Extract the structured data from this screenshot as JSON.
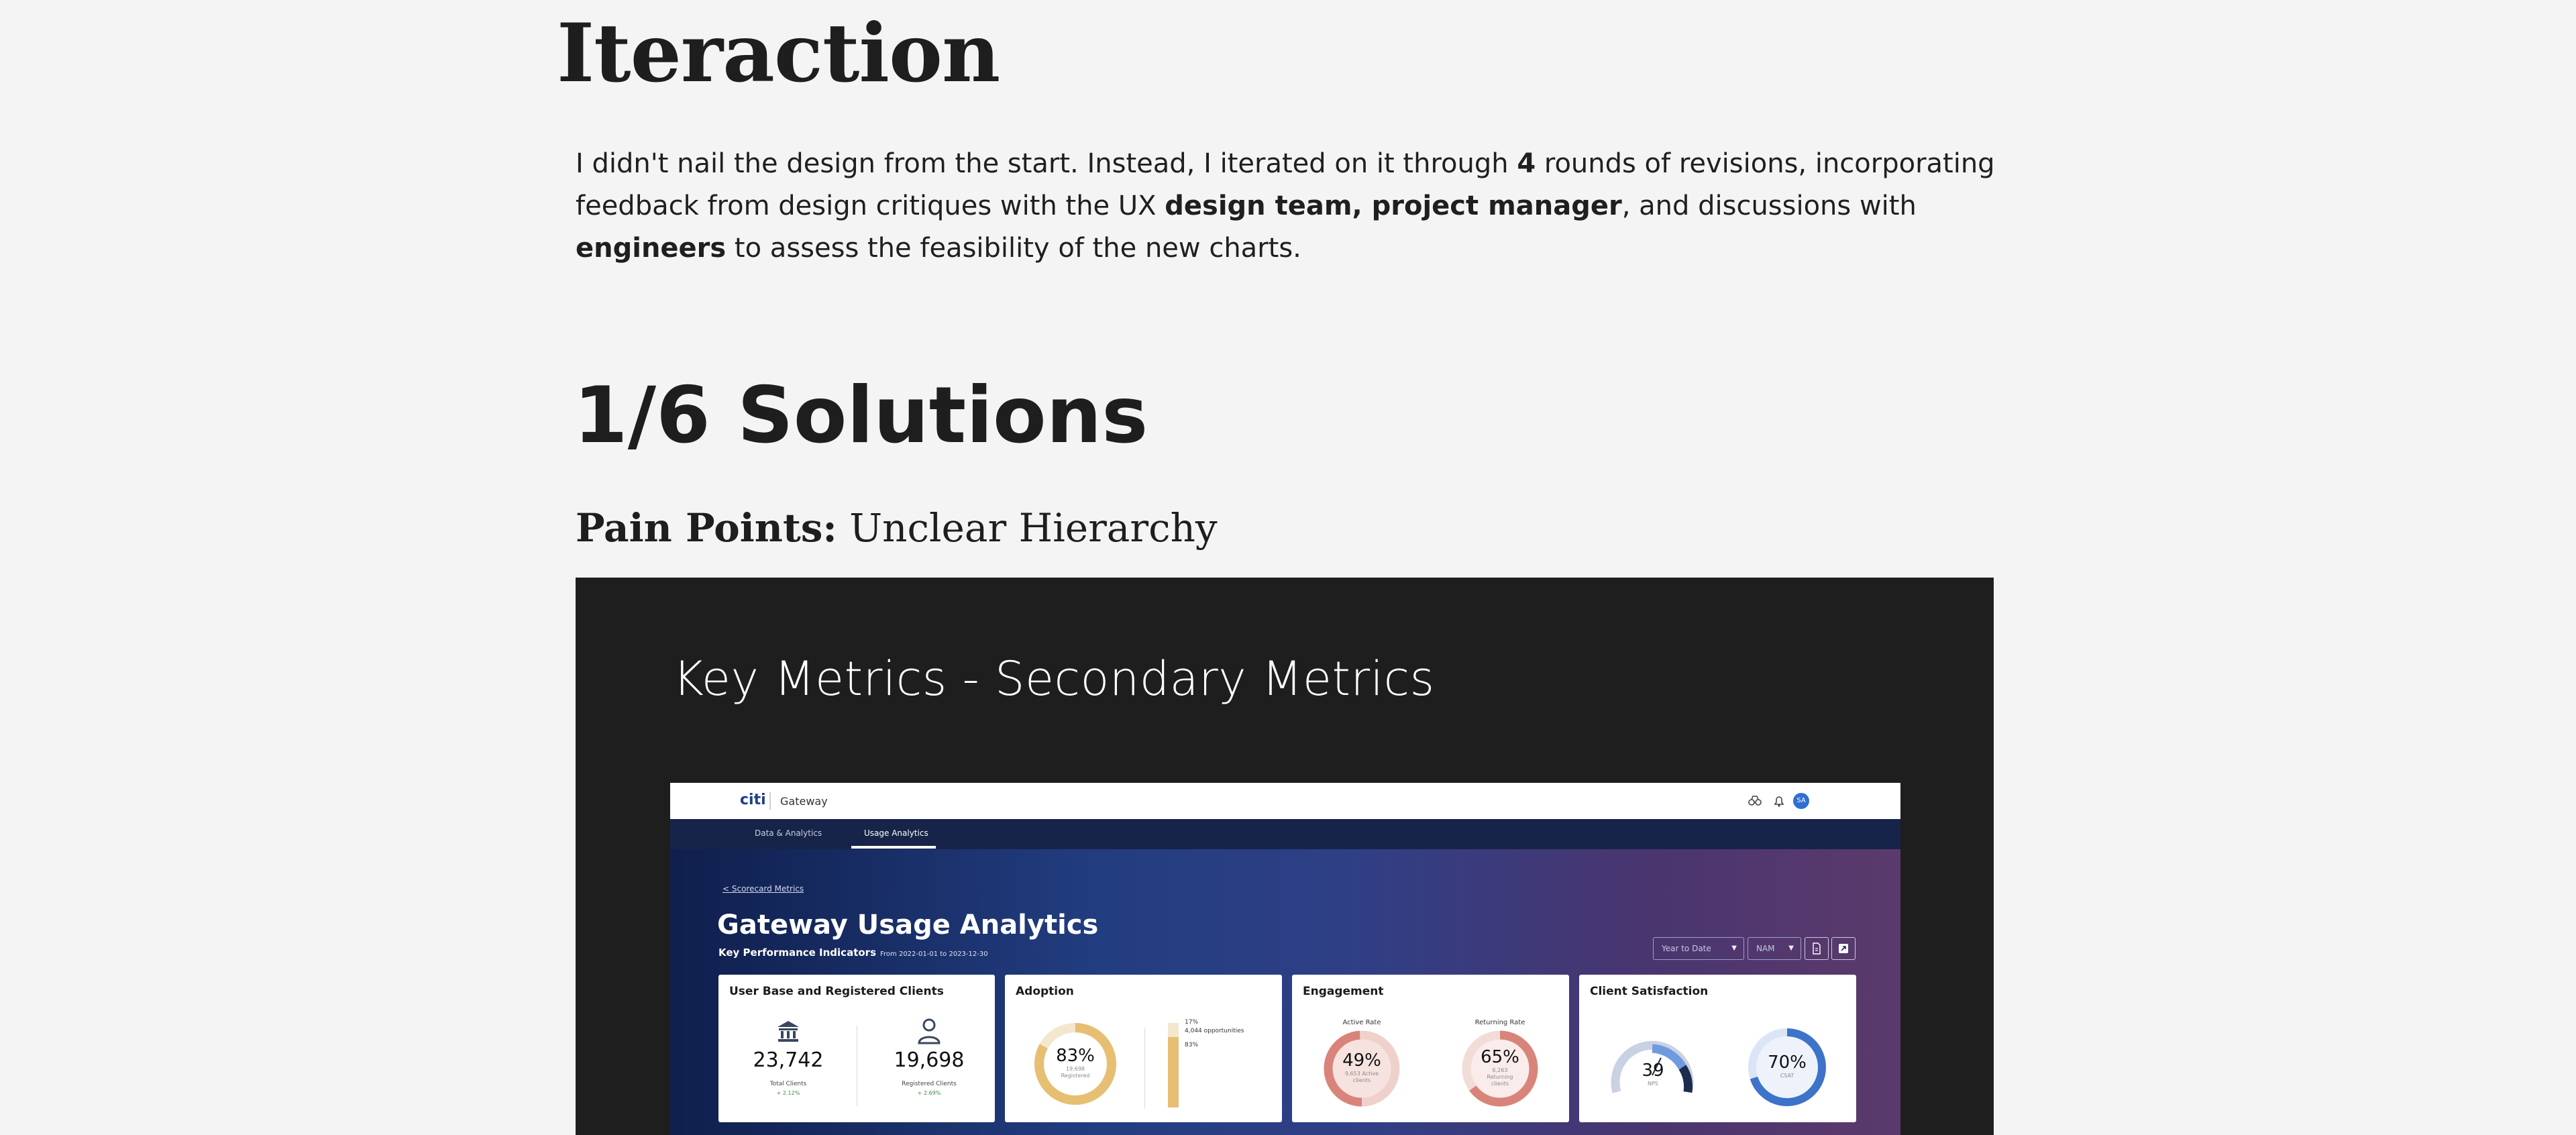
{
  "heading": "Iteraction",
  "intro": {
    "t1": "I didn't nail the design from the start. Instead, I iterated on it through ",
    "b1": "4",
    "t2": " rounds of revisions, incorporating feedback from design critiques with the UX ",
    "b2": "design team, project manager",
    "t3": ", and discussions with ",
    "b3": "engineers",
    "t4": " to assess the feasibility of the new charts."
  },
  "section_title": "1/6 Solutions",
  "pain_points": {
    "label": "Pain Points:",
    "value": " Unclear Hierarchy"
  },
  "panel": {
    "title": "Key Metrics - Secondary Metrics"
  },
  "app": {
    "logo": "citi",
    "product": "Gateway",
    "avatar": "SA",
    "tabs": [
      {
        "label": "Data & Analytics"
      },
      {
        "label": "Usage Analytics"
      }
    ],
    "back_link": "< Scorecard Metrics",
    "title": "Gateway Usage Analytics",
    "kpi_label": "Key Performance Indicators",
    "kpi_range": "From 2022-01-01 to 2023-12-30",
    "filters": {
      "period": "Year to Date",
      "region": "NAM"
    },
    "cards": {
      "users": {
        "title": "User Base and Registered Clients",
        "total_value": "23,742",
        "total_label": "Total Clients",
        "total_delta": "+ 2.12%",
        "registered_value": "19,698",
        "registered_label": "Registered Clients",
        "registered_delta": "+ 2.69%"
      },
      "adoption": {
        "title": "Adoption",
        "ring_pct": "83%",
        "ring_fill": 0.83,
        "ring_sub1": "19,698",
        "ring_sub2": "Registered",
        "bar_top": "17%",
        "bar_top_sub": "4,044 opportunities",
        "bar_bottom": "83%",
        "bar_fill": 0.83
      },
      "engagement": {
        "title": "Engagement",
        "active_label": "Active Rate",
        "active_pct": "49%",
        "active_fill": 0.49,
        "active_sub1": "9,653 Active",
        "active_sub2": "clients",
        "returning_label": "Returning Rate",
        "returning_pct": "65%",
        "returning_fill": 0.65,
        "returning_sub1": "6,263",
        "returning_sub2": "Returning",
        "returning_sub3": "clients"
      },
      "satisfaction": {
        "title": "Client Satisfaction",
        "nps_value": "39",
        "nps_label": "NPS",
        "csat_pct": "70%",
        "csat_fill": 0.7,
        "csat_label": "CSAT"
      }
    }
  },
  "colors": {
    "page_bg": "#f4f4f4",
    "panel_bg": "#1e1e1e",
    "adoption": "#e6bf73",
    "engagement": "#d9847a",
    "satisfaction_blue": "#3d73c9",
    "nps_navy": "#1d2b4f"
  },
  "icons": {
    "bank": "bank-icon",
    "user": "user-icon",
    "bell": "bell-icon",
    "binoculars": "binoculars-icon",
    "download": "download-icon",
    "expand": "expand-icon"
  }
}
